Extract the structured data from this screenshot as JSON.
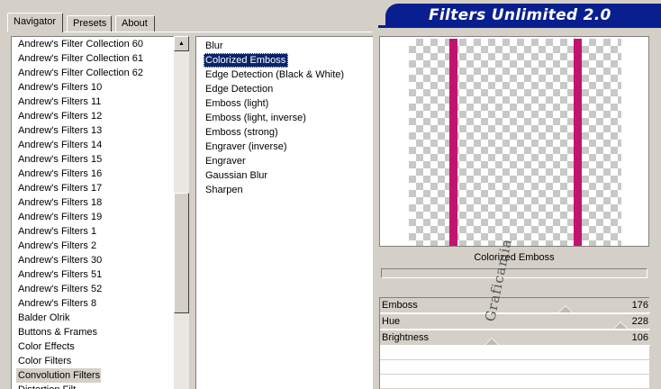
{
  "app": {
    "title": "Filters Unlimited 2.0"
  },
  "tabs": [
    {
      "label": "Navigator",
      "active": true
    },
    {
      "label": "Presets",
      "active": false
    },
    {
      "label": "About",
      "active": false
    }
  ],
  "categories": {
    "items": [
      "Andrew's Filter Collection 60",
      "Andrew's Filter Collection 61",
      "Andrew's Filter Collection 62",
      "Andrew's Filters 10",
      "Andrew's Filters 11",
      "Andrew's Filters 12",
      "Andrew's Filters 13",
      "Andrew's Filters 14",
      "Andrew's Filters 15",
      "Andrew's Filters 16",
      "Andrew's Filters 17",
      "Andrew's Filters 18",
      "Andrew's Filters 19",
      "Andrew's Filters 1",
      "Andrew's Filters 2",
      "Andrew's Filters 30",
      "Andrew's Filters 51",
      "Andrew's Filters 52",
      "Andrew's Filters 8",
      "Balder Olrik",
      "Buttons & Frames",
      "Color Effects",
      "Color Filters",
      "Convolution Filters",
      "Distortion Filt..."
    ],
    "selected": "Convolution Filters"
  },
  "filters": {
    "items": [
      "Blur",
      "Colorized Emboss",
      "Edge Detection (Black & White)",
      "Edge Detection",
      "Emboss (light)",
      "Emboss (light, inverse)",
      "Emboss (strong)",
      "Engraver (inverse)",
      "Engraver",
      "Gaussian Blur",
      "Sharpen"
    ],
    "selected": "Colorized Emboss"
  },
  "preview": {
    "caption": "Colorized Emboss",
    "stripe_color": "#c2136f"
  },
  "params": [
    {
      "label": "Emboss",
      "value": "176"
    },
    {
      "label": "Hue",
      "value": "228"
    },
    {
      "label": "Brightness",
      "value": "106"
    }
  ],
  "watermark": "Graficamia"
}
